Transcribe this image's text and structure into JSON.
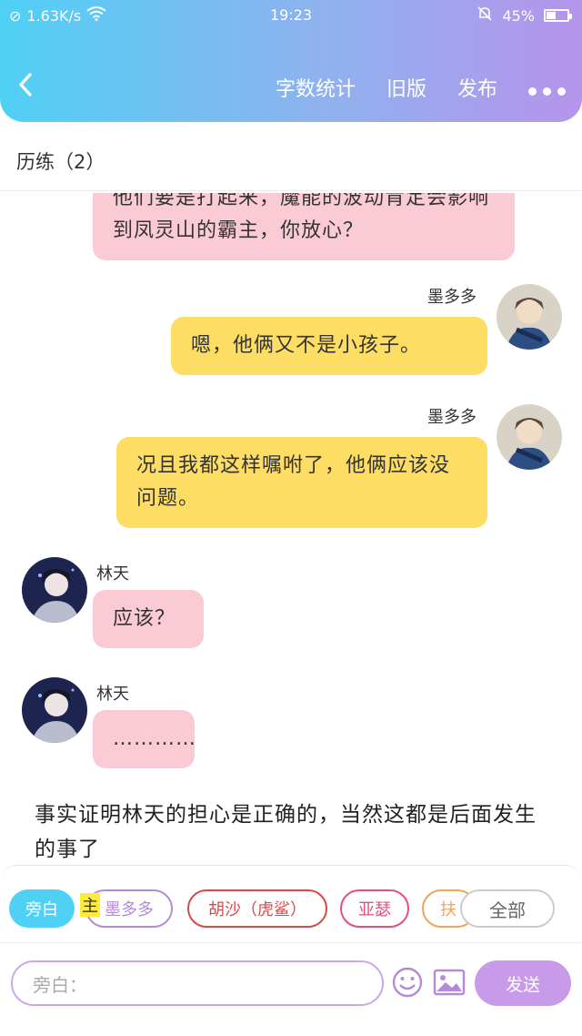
{
  "status": {
    "speed": "1.63K/s",
    "time": "19:23",
    "battery": "45%",
    "battery_level": 0.45
  },
  "nav": {
    "back_icon": "chevron-left-icon",
    "word_count": "字数统计",
    "old_version": "旧版",
    "publish": "发布"
  },
  "section": {
    "title": "历练（2）"
  },
  "messages": [
    {
      "text": "他们要是打起来，魔能的波动肯定会影响到凤灵山的霸主，你放心？"
    },
    {
      "name": "墨多多",
      "text": "嗯，他俩又不是小孩子。"
    },
    {
      "name": "墨多多",
      "text": "况且我都这样嘱咐了，他俩应该没问题。"
    },
    {
      "name": "林天",
      "text": "应该？"
    },
    {
      "name": "林天",
      "text": "…………"
    }
  ],
  "narration": "事实证明林天的担心是正确的，当然这都是后面发生的事了",
  "composer": {
    "chips": {
      "narrator": "旁白",
      "moduoduo": "墨多多",
      "husha": "胡沙（虎鲨）",
      "yase": "亚瑟",
      "partial": "扶",
      "all": "全部"
    },
    "main_tag": "主",
    "placeholder": "旁白：",
    "send": "发送"
  },
  "colors": {
    "pink_bubble": "#fbcbd5",
    "yellow_bubble": "#fddd63",
    "accent": "#c79bea"
  }
}
